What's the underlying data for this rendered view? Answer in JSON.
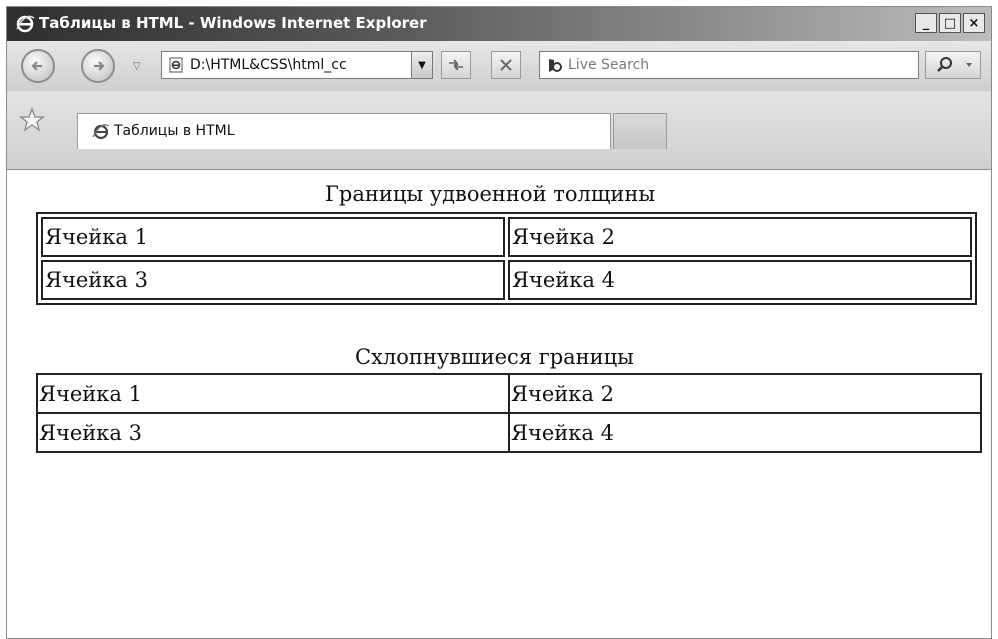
{
  "window": {
    "title": "Таблицы в HTML - Windows Internet Explorer",
    "buttons": {
      "minimize": "_",
      "maximize": "□",
      "close": "×"
    }
  },
  "navbar": {
    "address": "D:\\HTML&CSS\\html_cc",
    "search_placeholder": "Live Search"
  },
  "tabs": [
    {
      "label": "Таблицы в HTML"
    }
  ],
  "content": {
    "table1": {
      "caption": "Границы удвоенной толщины",
      "rows": [
        [
          "Ячейка 1",
          "Ячейка 2"
        ],
        [
          "Ячейка 3",
          "Ячейка 4"
        ]
      ]
    },
    "table2": {
      "caption": "Схлопнувшиеся границы",
      "rows": [
        [
          "Ячейка 1",
          "Ячейка 2"
        ],
        [
          "Ячейка 3",
          "Ячейка 4"
        ]
      ]
    }
  },
  "icons": [
    "ie-logo-icon",
    "back-icon",
    "forward-icon",
    "page-icon",
    "refresh-icon",
    "stop-icon",
    "bing-icon",
    "search-icon",
    "favorites-star-icon"
  ]
}
